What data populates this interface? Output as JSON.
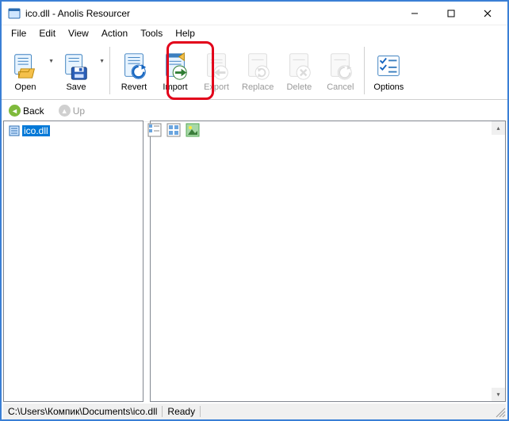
{
  "window": {
    "title": "ico.dll - Anolis Resourcer"
  },
  "menu": {
    "file": "File",
    "edit": "Edit",
    "view": "View",
    "action": "Action",
    "tools": "Tools",
    "help": "Help"
  },
  "toolbar": {
    "open": {
      "label": "Open"
    },
    "save": {
      "label": "Save"
    },
    "revert": {
      "label": "Revert"
    },
    "import": {
      "label": "Import"
    },
    "export": {
      "label": "Export"
    },
    "replace": {
      "label": "Replace"
    },
    "delete": {
      "label": "Delete"
    },
    "cancel": {
      "label": "Cancel"
    },
    "options": {
      "label": "Options"
    }
  },
  "nav": {
    "back": "Back",
    "up": "Up"
  },
  "tree": {
    "items": [
      "ico.dll"
    ]
  },
  "status": {
    "path": "C:\\Users\\Компик\\Documents\\ico.dll",
    "state": "Ready"
  }
}
